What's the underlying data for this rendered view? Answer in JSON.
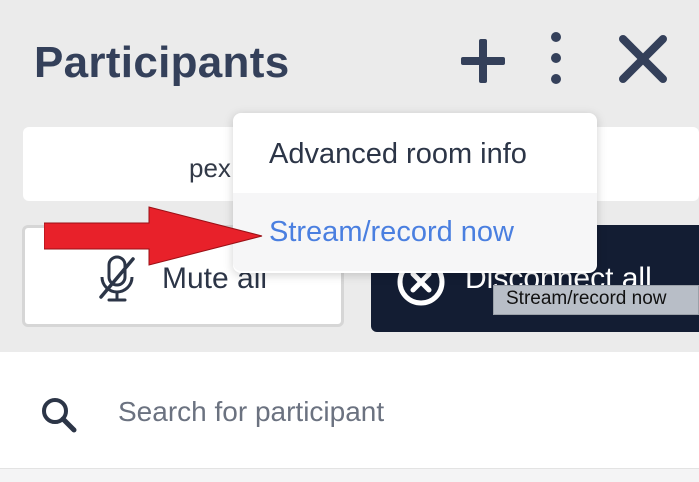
{
  "header": {
    "title": "Participants",
    "icons": {
      "add": "plus-icon",
      "more": "vertical-dots-icon",
      "close": "close-icon"
    }
  },
  "room": {
    "text": "pex"
  },
  "actions": {
    "mute_all_label": "Mute all",
    "disconnect_all_label": "Disconnect all"
  },
  "search": {
    "placeholder": "Search for participant",
    "value": ""
  },
  "menu": {
    "items": [
      {
        "label": "Advanced room info"
      },
      {
        "label": "Stream/record now"
      }
    ]
  },
  "tooltip": {
    "text": "Stream/record now"
  },
  "colors": {
    "text_dark": "#34405a",
    "link_blue": "#4a7fe0",
    "disconnect_bg": "#131d33",
    "annotation_red": "#e8212a"
  }
}
